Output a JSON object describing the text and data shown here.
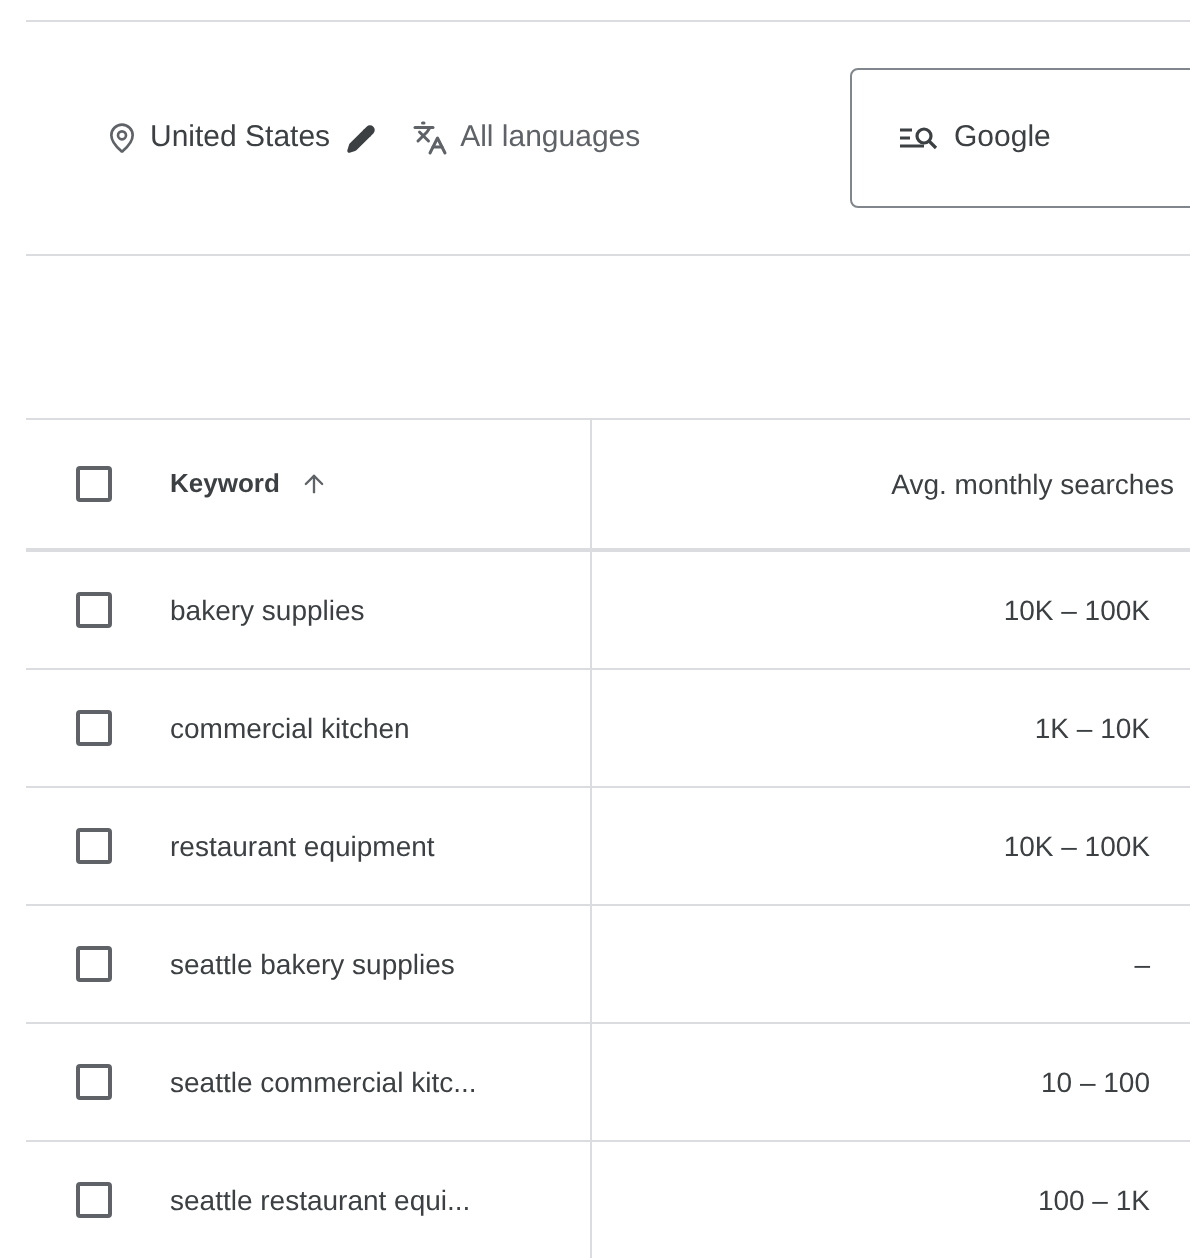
{
  "filters": {
    "location": "United States",
    "language": "All languages",
    "network": "Google"
  },
  "table": {
    "columns": [
      {
        "label": "Keyword",
        "sort_ascending": true
      },
      {
        "label": "Avg. monthly searches"
      }
    ],
    "header_checked": false,
    "rows": [
      {
        "keyword": "bakery supplies",
        "searches": "10K – 100K",
        "checked": false
      },
      {
        "keyword": "commercial kitchen",
        "searches": "1K – 10K",
        "checked": false
      },
      {
        "keyword": "restaurant equipment",
        "searches": "10K – 100K",
        "checked": false
      },
      {
        "keyword": "seattle bakery supplies",
        "searches": "–",
        "checked": false
      },
      {
        "keyword": "seattle commercial kitc...",
        "searches": "10 – 100",
        "checked": false
      },
      {
        "keyword": "seattle restaurant equi...",
        "searches": "100 – 1K",
        "checked": false
      }
    ]
  }
}
